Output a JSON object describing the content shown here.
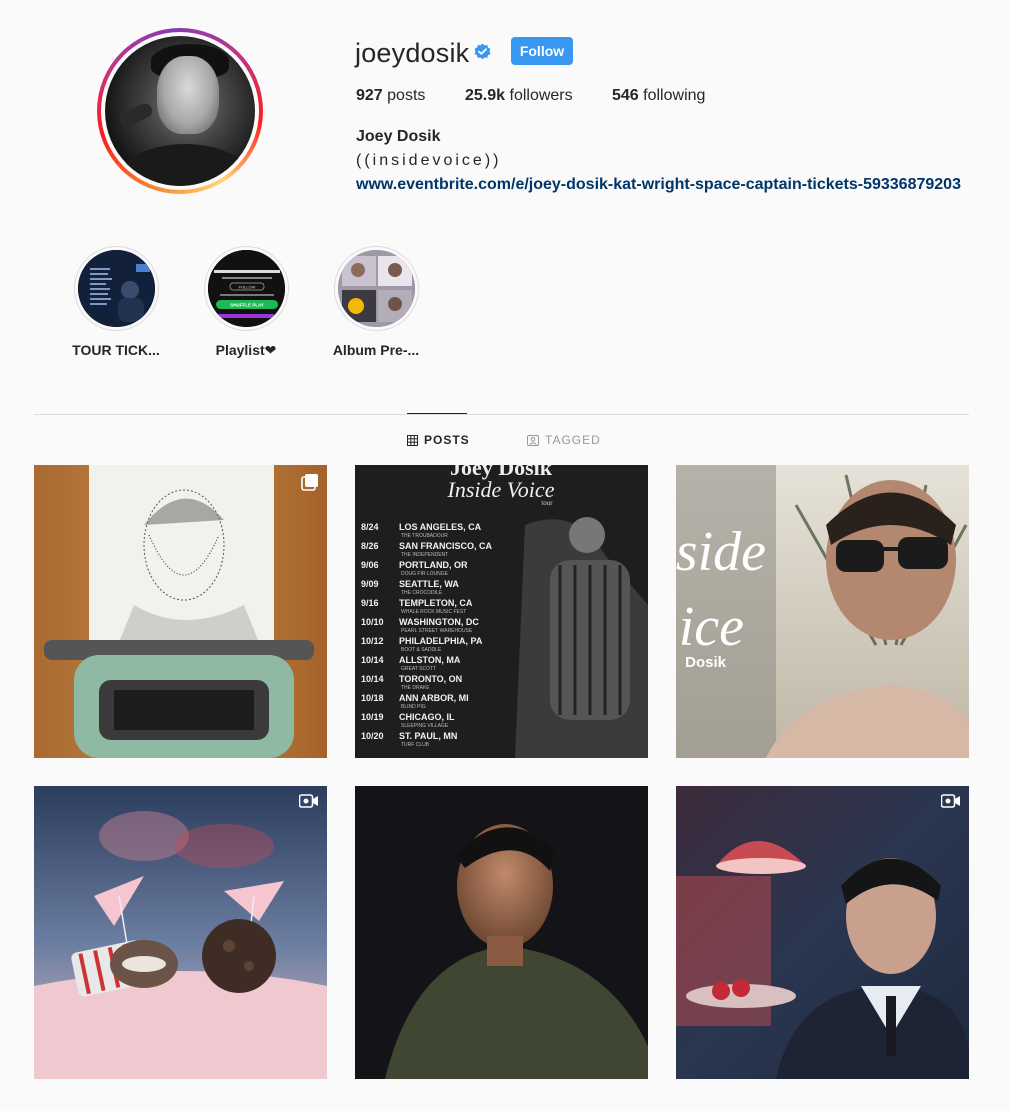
{
  "profile": {
    "username": "joeydosik",
    "verified": true,
    "follow_label": "Follow",
    "posts_count": "927",
    "posts_label": "posts",
    "followers_count": "25.9k",
    "followers_label": "followers",
    "following_count": "546",
    "following_label": "following",
    "full_name": "Joey Dosik",
    "bio": "((insidevoice))",
    "link": "www.eventbrite.com/e/joey-dosik-kat-wright-space-captain-tickets-59336879203"
  },
  "highlights": [
    {
      "label": "TOUR TICK..."
    },
    {
      "label": "Playlist❤"
    },
    {
      "label": "Album Pre-..."
    }
  ],
  "highlight_art": {
    "playlist_button": "SHUFFLE PLAY",
    "playlist_follow": "FOLLOW"
  },
  "tabs": {
    "posts": "POSTS",
    "tagged": "TAGGED"
  },
  "posts": {
    "tour_poster": {
      "header": "Joey Dosik",
      "title": "Inside Voice",
      "subtitle": "tour",
      "dates": [
        {
          "date": "8/24",
          "city": "LOS ANGELES, CA",
          "venue": "THE TROUBADOUR"
        },
        {
          "date": "8/26",
          "city": "SAN FRANCISCO, CA",
          "venue": "THE INDEPENDENT"
        },
        {
          "date": "9/06",
          "city": "PORTLAND, OR",
          "venue": "DOUG FIR LOUNGE"
        },
        {
          "date": "9/09",
          "city": "SEATTLE, WA",
          "venue": "THE CROCODILE"
        },
        {
          "date": "9/16",
          "city": "TEMPLETON, CA",
          "venue": "WHALE ROCK MUSIC FEST"
        },
        {
          "date": "10/10",
          "city": "WASHINGTON, DC",
          "venue": "PEARL STREET WAREHOUSE"
        },
        {
          "date": "10/12",
          "city": "PHILADELPHIA, PA",
          "venue": "BOOT & SADDLE"
        },
        {
          "date": "10/14",
          "city": "ALLSTON, MA",
          "venue": "GREAT SCOTT"
        },
        {
          "date": "10/14",
          "city": "TORONTO, ON",
          "venue": "THE DRAKE"
        },
        {
          "date": "10/18",
          "city": "ANN ARBOR, MI",
          "venue": "BLIND PIG"
        },
        {
          "date": "10/19",
          "city": "CHICAGO, IL",
          "venue": "SLEEPING VILLAGE"
        },
        {
          "date": "10/20",
          "city": "ST. PAUL, MN",
          "venue": "TURF CLUB"
        }
      ]
    },
    "album_art": {
      "line1": "side",
      "line2": "ice",
      "line3": "Dosik"
    }
  },
  "colors": {
    "follow_button": "#3897f0",
    "link": "#003569",
    "verified_badge": "#3897f0"
  },
  "icons": {
    "verified": "verified-badge-icon",
    "grid": "grid-icon",
    "tagged": "tagged-user-icon",
    "carousel": "carousel-icon",
    "video": "video-icon"
  }
}
